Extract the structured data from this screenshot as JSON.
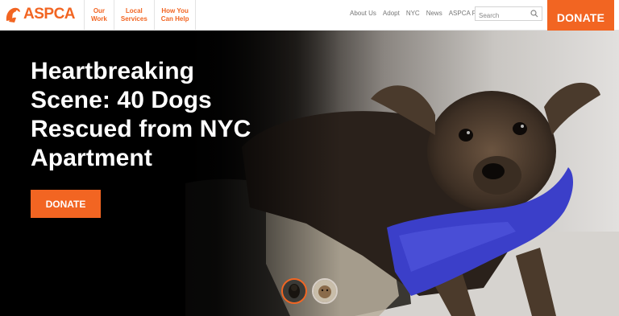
{
  "brand": {
    "logo_text": "ASPCA",
    "accent": "#f26522"
  },
  "primary_nav": [
    {
      "line1": "Our",
      "line2": "Work"
    },
    {
      "line1": "Local",
      "line2": "Services"
    },
    {
      "line1": "How You",
      "line2": "Can Help"
    }
  ],
  "utility_nav": [
    "About Us",
    "Adopt",
    "NYC",
    "News",
    "ASPCA Pro"
  ],
  "search": {
    "placeholder": "Search",
    "icon": "search-icon"
  },
  "header_donate": "DONATE",
  "hero": {
    "title": "Heartbreaking Scene: 40 Dogs Rescued from NYC Apartment",
    "donate_label": "DONATE"
  },
  "carousel": {
    "active_index": 0,
    "count": 2
  }
}
